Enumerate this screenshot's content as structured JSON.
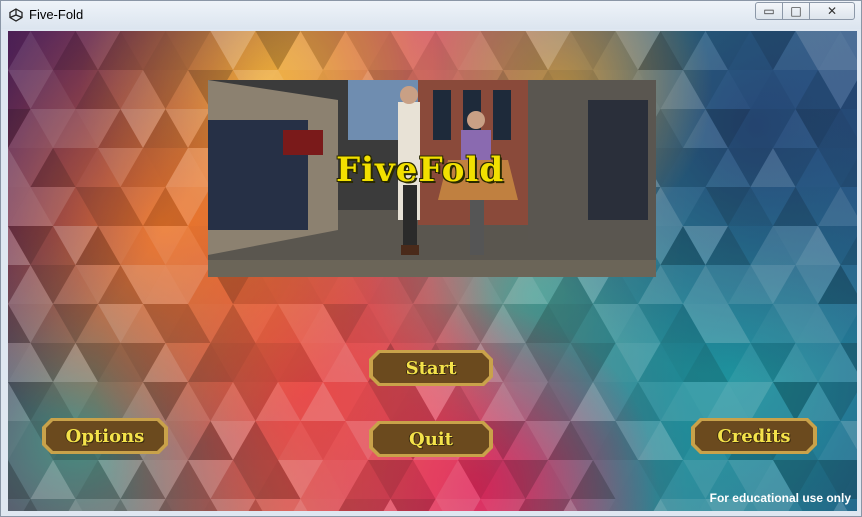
{
  "window": {
    "title": "Five-Fold",
    "controls": {
      "minimize": "▭",
      "maximize": "□",
      "close": "✕"
    }
  },
  "banner": {
    "logo": "FiveFold"
  },
  "buttons": {
    "start": "Start",
    "quit": "Quit",
    "options": "Options",
    "credits": "Credits"
  },
  "footer": {
    "notice": "For educational use only"
  },
  "colors": {
    "button_text": "#f4e24a",
    "button_plate": "#6b4a1e",
    "button_rim": "#c9a24a"
  }
}
